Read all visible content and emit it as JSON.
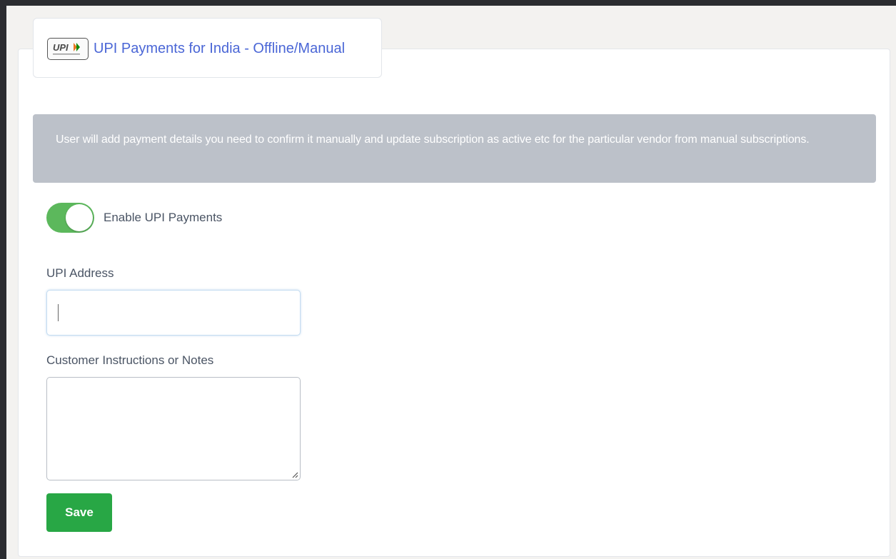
{
  "header": {
    "logo_icon": "upi-logo-icon",
    "title": "UPI Payments for India - Offline/Manual",
    "title_color": "#4a66d6"
  },
  "info": {
    "text": "User will add payment details you need to confirm it manually and update subscription as active etc for the particular vendor from manual subscriptions.",
    "background": "#bcc1c9"
  },
  "toggle": {
    "label": "Enable UPI Payments",
    "enabled": true,
    "color": "#5cb85c"
  },
  "upi_address": {
    "label": "UPI Address",
    "value": "",
    "placeholder": ""
  },
  "notes": {
    "label": "Customer Instructions or Notes",
    "value": ""
  },
  "actions": {
    "save_label": "Save",
    "save_color": "#28a745"
  }
}
